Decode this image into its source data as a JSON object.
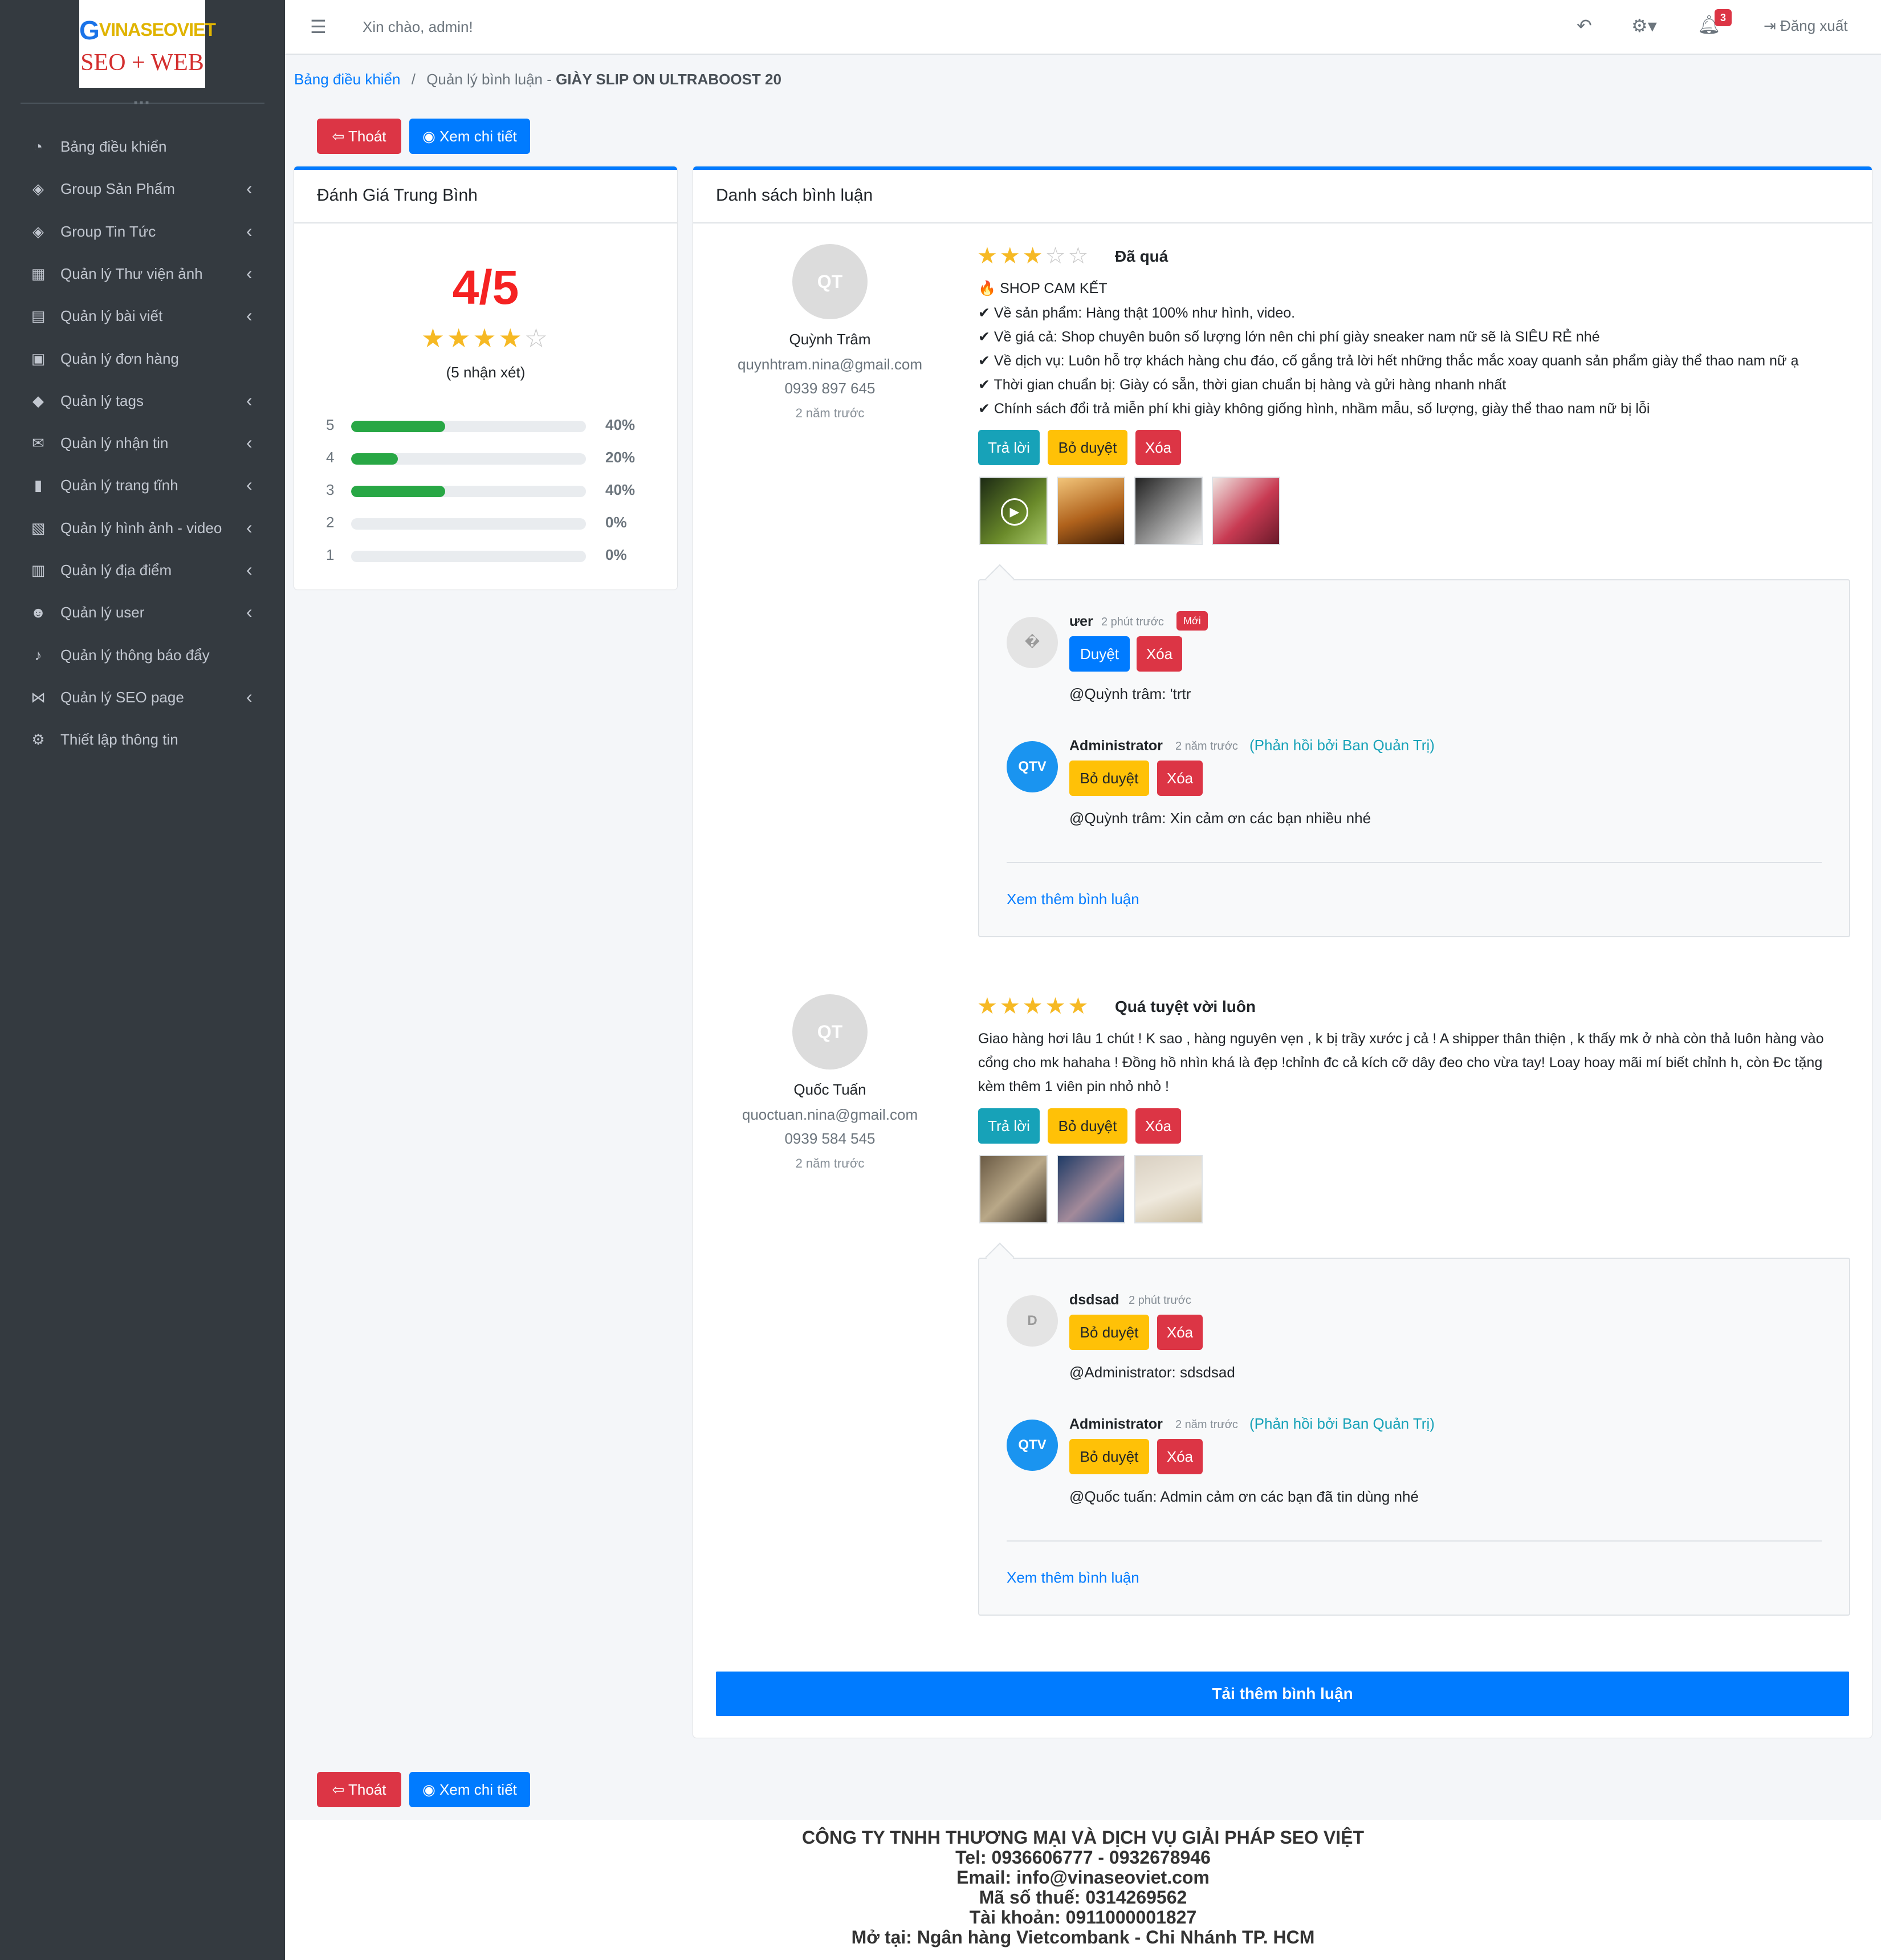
{
  "logo": {
    "brand_text": "VINASEOVIET",
    "sub_text": "SEO + WEB"
  },
  "sidebar": {
    "items": [
      {
        "label": "Bảng điều khiển",
        "icon": "dashboard-icon",
        "has_children": false
      },
      {
        "label": "Group Sản Phẩm",
        "icon": "layers-icon",
        "has_children": true
      },
      {
        "label": "Group Tin Tức",
        "icon": "layers-icon",
        "has_children": true
      },
      {
        "label": "Quản lý Thư viện ảnh",
        "icon": "cubes-icon",
        "has_children": true
      },
      {
        "label": "Quản lý bài viết",
        "icon": "newspaper-icon",
        "has_children": true
      },
      {
        "label": "Quản lý đơn hàng",
        "icon": "shopping-bag-icon",
        "has_children": false
      },
      {
        "label": "Quản lý tags",
        "icon": "tags-icon",
        "has_children": true
      },
      {
        "label": "Quản lý nhận tin",
        "icon": "envelope-icon",
        "has_children": true
      },
      {
        "label": "Quản lý trang tĩnh",
        "icon": "bookmark-icon",
        "has_children": true
      },
      {
        "label": "Quản lý hình ảnh - video",
        "icon": "photo-video-icon",
        "has_children": true
      },
      {
        "label": "Quản lý địa điểm",
        "icon": "building-icon",
        "has_children": true
      },
      {
        "label": "Quản lý user",
        "icon": "users-icon",
        "has_children": true
      },
      {
        "label": "Quản lý thông báo đẩy",
        "icon": "bell-icon",
        "has_children": false
      },
      {
        "label": "Quản lý SEO page",
        "icon": "share-icon",
        "has_children": true
      },
      {
        "label": "Thiết lập thông tin",
        "icon": "cogs-icon",
        "has_children": false
      }
    ]
  },
  "topbar": {
    "greeting": "Xin chào, admin!",
    "notification_count": "3",
    "logout_label": "Đăng xuất"
  },
  "breadcrumb": {
    "home": "Bảng điều khiển",
    "separator": "/",
    "current_prefix": "Quản lý bình luận - ",
    "current_product": "GIÀY SLIP ON ULTRABOOST 20"
  },
  "actions": {
    "exit_label": "Thoát",
    "view_label": "Xem chi tiết"
  },
  "rating_summary": {
    "title": "Đánh Giá Trung Bình",
    "average": "4/5",
    "average_stars": 4,
    "count_text": "(5 nhận xét)",
    "rows": [
      {
        "star": "5",
        "percent_label": "40%",
        "fraction": 0.4
      },
      {
        "star": "4",
        "percent_label": "20%",
        "fraction": 0.2
      },
      {
        "star": "3",
        "percent_label": "40%",
        "fraction": 0.4
      },
      {
        "star": "2",
        "percent_label": "0%",
        "fraction": 0
      },
      {
        "star": "1",
        "percent_label": "0%",
        "fraction": 0
      }
    ]
  },
  "comment_list": {
    "title": "Danh sách bình luận",
    "reply_label": "Trả lời",
    "unapprove_label": "Bỏ duyệt",
    "approve_label": "Duyệt",
    "delete_label": "Xóa",
    "admin_note": "(Phản hồi bởi Ban Quản Trị)",
    "new_badge": "Mới",
    "more_replies": "Xem thêm bình luận",
    "load_more": "Tải thêm bình luận",
    "comments": [
      {
        "initials": "QT",
        "name": "Quỳnh Trâm",
        "email": "quynhtram.nina@gmail.com",
        "phone": "0939 897 645",
        "time": "2 năm trước",
        "stars": 3,
        "title": "Đã quá",
        "lines": [
          "🔥 SHOP CAM KẾT",
          "✔ Về sản phẩm: Hàng thật 100% như hình, video.",
          "✔ Về giá cả: Shop chuyên buôn số lượng lớn nên chi phí giày sneaker nam nữ sẽ là SIÊU RẺ nhé",
          "✔ Về dịch vụ: Luôn hỗ trợ khách hàng chu đáo, cố gắng trả lời hết những thắc mắc xoay quanh sản phẩm giày thể thao nam nữ ạ",
          "✔ Thời gian chuẩn bị: Giày có sẵn, thời gian chuẩn bị hàng và gửi hàng nhanh nhất",
          "✔ Chính sách đổi trả miễn phí khi giày không giống hình, nhầm mẫu, số lượng, giày thể thao nam nữ bị lỗi"
        ],
        "replies": [
          {
            "initials": "�",
            "name": "ưer",
            "time": "2 phút trước",
            "is_new": true,
            "is_admin": false,
            "text": "@Quỳnh trâm: 'trtr"
          },
          {
            "initials": "QTV",
            "name": "Administrator",
            "time": "2 năm trước",
            "is_new": false,
            "is_admin": true,
            "text": "@Quỳnh trâm: Xin cảm ơn các bạn nhiều nhé"
          }
        ]
      },
      {
        "initials": "QT",
        "name": "Quốc Tuấn",
        "email": "quoctuan.nina@gmail.com",
        "phone": "0939 584 545",
        "time": "2 năm trước",
        "stars": 5,
        "title": "Quá tuyệt vời luôn",
        "lines": [
          "Giao hàng hơi lâu 1 chút ! K sao , hàng nguyên vẹn , k bị trầy xước j cả ! A shipper thân thiện , k thấy mk ở nhà còn thả luôn hàng vào",
          "cổng cho mk hahaha ! Đồng hồ nhìn khá là đẹp !chỉnh đc cả kích cỡ dây đeo cho vừa tay! Loay hoay mãi mí biết chỉnh h, còn Đc tặng",
          "kèm thêm 1 viên pin nhỏ nhỏ !"
        ],
        "replies": [
          {
            "initials": "D",
            "name": "dsdsad",
            "time": "2 phút trước",
            "is_new": false,
            "is_admin": false,
            "text": "@Administrator: sdsdsad"
          },
          {
            "initials": "QTV",
            "name": "Administrator",
            "time": "2 năm trước",
            "is_new": false,
            "is_admin": true,
            "text": "@Quốc tuấn: Admin cảm ơn các bạn đã tin dùng nhé"
          }
        ]
      }
    ]
  },
  "footer": {
    "company": "CÔNG TY TNHH THƯƠNG MẠI VÀ DỊCH VỤ GIẢI PHÁP SEO VIỆT",
    "tel": "Tel: 0936606777 - 0932678946",
    "email": "Email: info@vinaseoviet.com",
    "tax": "Mã số thuế: 0314269562",
    "account": "Tài khoản: 0911000001827",
    "bank": "Mở tại: Ngân hàng Vietcombank - Chi Nhánh TP. HCM"
  },
  "colors": {
    "accent": "#007bff",
    "danger": "#dc3545",
    "warning": "#ffc107",
    "info": "#17a2b8",
    "success": "#28a745",
    "sidebar": "#343a40",
    "star": "#f6b924",
    "rating": "#f52222"
  }
}
